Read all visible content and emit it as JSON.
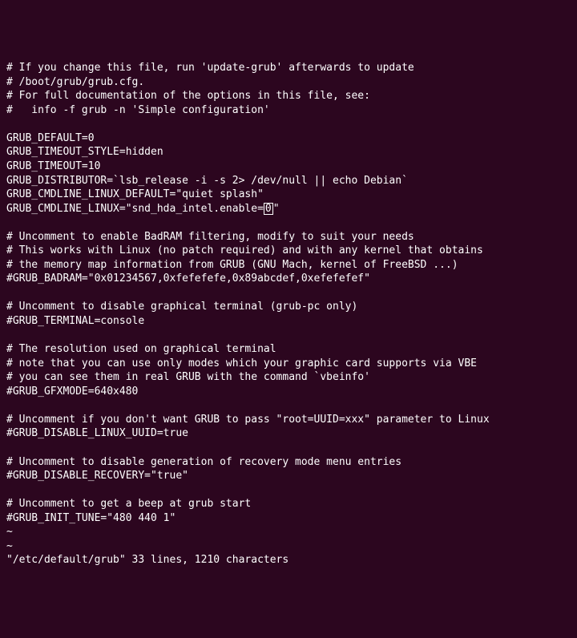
{
  "colors": {
    "bg": "#2c061f",
    "fg": "#ffffff"
  },
  "cursor_char": "0",
  "lines": [
    "# If you change this file, run 'update-grub' afterwards to update",
    "# /boot/grub/grub.cfg.",
    "# For full documentation of the options in this file, see:",
    "#   info -f grub -n 'Simple configuration'",
    "",
    "GRUB_DEFAULT=0",
    "GRUB_TIMEOUT_STYLE=hidden",
    "GRUB_TIMEOUT=10",
    "GRUB_DISTRIBUTOR=`lsb_release -i -s 2> /dev/null || echo Debian`",
    "GRUB_CMDLINE_LINUX_DEFAULT=\"quiet splash\"",
    {
      "pre": "GRUB_CMDLINE_LINUX=\"snd_hda_intel.enable=",
      "cursor": "0",
      "post": "\""
    },
    "",
    "# Uncomment to enable BadRAM filtering, modify to suit your needs",
    "# This works with Linux (no patch required) and with any kernel that obtains",
    "# the memory map information from GRUB (GNU Mach, kernel of FreeBSD ...)",
    "#GRUB_BADRAM=\"0x01234567,0xfefefefe,0x89abcdef,0xefefefef\"",
    "",
    "# Uncomment to disable graphical terminal (grub-pc only)",
    "#GRUB_TERMINAL=console",
    "",
    "# The resolution used on graphical terminal",
    "# note that you can use only modes which your graphic card supports via VBE",
    "# you can see them in real GRUB with the command `vbeinfo'",
    "#GRUB_GFXMODE=640x480",
    "",
    "# Uncomment if you don't want GRUB to pass \"root=UUID=xxx\" parameter to Linux",
    "#GRUB_DISABLE_LINUX_UUID=true",
    "",
    "# Uncomment to disable generation of recovery mode menu entries",
    "#GRUB_DISABLE_RECOVERY=\"true\"",
    "",
    "# Uncomment to get a beep at grub start",
    "#GRUB_INIT_TUNE=\"480 440 1\"",
    "~",
    "~",
    "\"/etc/default/grub\" 33 lines, 1210 characters"
  ],
  "status": {
    "file": "/etc/default/grub",
    "line_count": 33,
    "char_count": 1210
  }
}
